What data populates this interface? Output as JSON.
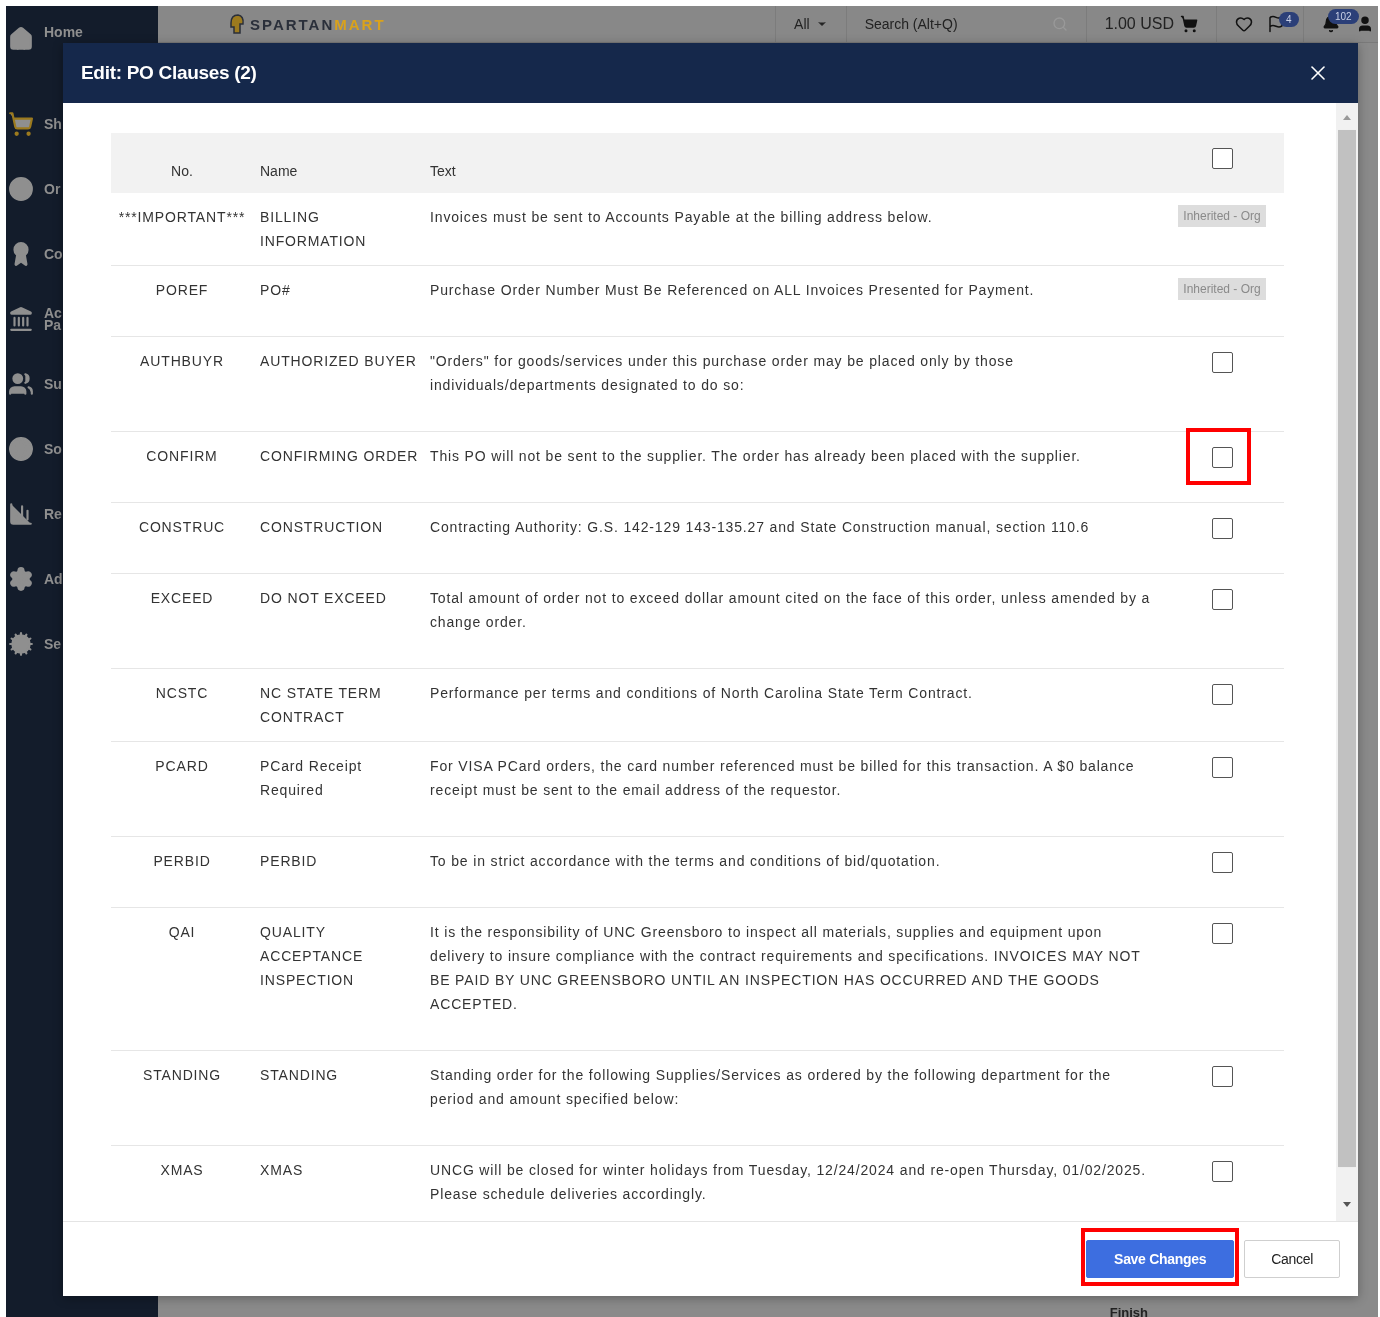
{
  "background": {
    "logo": {
      "part_1": "SPARTAN",
      "part_2": "MART"
    },
    "scope": "All",
    "search_placeholder": "Search (Alt+Q)",
    "cart_total": "1.00 USD",
    "flag_badge": "4",
    "bell_badge": "102",
    "finish_label": "Finish",
    "sidebar": [
      {
        "lines": [
          "Home"
        ]
      },
      {
        "lines": [
          "Sh"
        ]
      },
      {
        "lines": [
          "Or"
        ]
      },
      {
        "lines": [
          "Co"
        ]
      },
      {
        "lines": [
          "Ac",
          "Pa"
        ]
      },
      {
        "lines": [
          "Su"
        ]
      },
      {
        "lines": [
          "So"
        ]
      },
      {
        "lines": [
          "Re"
        ]
      },
      {
        "lines": [
          "Ad"
        ]
      },
      {
        "lines": [
          "Se"
        ]
      }
    ]
  },
  "dialog": {
    "title": "Edit: PO Clauses (2)",
    "columns": [
      "No.",
      "Name",
      "Text"
    ],
    "select_all_checked": false,
    "rows": [
      {
        "no": "***IMPORTANT***",
        "name": "BILLING INFORMATION",
        "text": "Invoices must be sent to Accounts Payable at the billing address below.",
        "kind": "inherited",
        "badge": "Inherited - Org"
      },
      {
        "no": "POREF",
        "name": "PO#",
        "text": "Purchase Order Number Must Be Referenced on ALL Invoices Presented for Payment.",
        "kind": "inherited",
        "badge": "Inherited - Org"
      },
      {
        "no": "AUTHBUYR",
        "name": "AUTHORIZED BUYER",
        "text": "\"Orders\" for goods/services under this purchase order may be placed only by those individuals/departments designated to do so:",
        "kind": "checkbox",
        "checked": false,
        "highlighted": false
      },
      {
        "no": "CONFIRM",
        "name": "CONFIRMING ORDER",
        "text": "This PO will not be sent to the supplier. The order has already been placed with the supplier.",
        "kind": "checkbox",
        "checked": false,
        "highlighted": true
      },
      {
        "no": "CONSTRUC",
        "name": "CONSTRUCTION",
        "text": "Contracting Authority: G.S. 142-129 143-135.27 and State Construction manual, section 110.6",
        "kind": "checkbox",
        "checked": false,
        "highlighted": false
      },
      {
        "no": "EXCEED",
        "name": "DO NOT EXCEED",
        "text": "Total amount of order not to exceed dollar amount cited on the face of this order, unless amended by a change order.",
        "kind": "checkbox",
        "checked": false,
        "highlighted": false
      },
      {
        "no": "NCSTC",
        "name": "NC STATE TERM CONTRACT",
        "text": "Performance per terms and conditions of North Carolina State Term Contract.",
        "kind": "checkbox",
        "checked": false,
        "highlighted": false
      },
      {
        "no": "PCARD",
        "name": "PCard Receipt Required",
        "text": "For VISA PCard orders, the card number referenced must be billed for this transaction. A $0 balance receipt must be sent to the email address of the requestor.",
        "kind": "checkbox",
        "checked": false,
        "highlighted": false
      },
      {
        "no": "PERBID",
        "name": "PERBID",
        "text": "To be in strict accordance with the terms and conditions of bid/quotation.",
        "kind": "checkbox",
        "checked": false,
        "highlighted": false
      },
      {
        "no": "QAI",
        "name": "QUALITY ACCEPTANCE INSPECTION",
        "text": "It is the responsibility of UNC Greensboro to inspect all materials, supplies and equipment upon delivery to insure compliance with the contract requirements and specifications. INVOICES MAY NOT BE PAID BY UNC GREENSBORO UNTIL AN INSPECTION HAS OCCURRED AND THE GOODS ACCEPTED.",
        "kind": "checkbox",
        "checked": false,
        "highlighted": false
      },
      {
        "no": "STANDING",
        "name": "STANDING",
        "text": "Standing order for the following Supplies/Services as ordered by the following department for the period and amount specified below:",
        "kind": "checkbox",
        "checked": false,
        "highlighted": false
      },
      {
        "no": "XMAS",
        "name": "XMAS",
        "text": "UNCG will be closed for winter holidays from Tuesday, 12/24/2024 and re-open Thursday, 01/02/2025. Please schedule deliveries accordingly.",
        "kind": "checkbox",
        "checked": false,
        "highlighted": false
      }
    ],
    "buttons": [
      {
        "label": "Save Changes",
        "kind": "primary",
        "highlighted": true
      },
      {
        "label": "Cancel",
        "kind": "secondary",
        "highlighted": false
      }
    ]
  }
}
